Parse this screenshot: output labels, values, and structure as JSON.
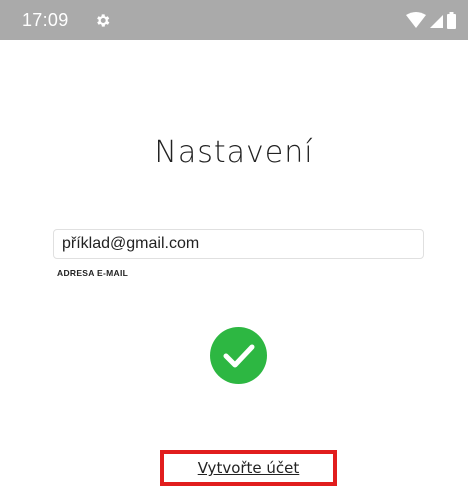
{
  "status_bar": {
    "time": "17:09",
    "icons": [
      "settings-gear-icon",
      "wifi-icon",
      "signal-icon",
      "battery-icon"
    ],
    "background": "#aaaaaa"
  },
  "screen": {
    "title": "Nastavení",
    "email": {
      "value": "příklad@gmail.com",
      "label": "ADRESA E-MAIL"
    },
    "success_icon": "check-circle-icon",
    "success_color": "#2db742",
    "create_account_link": "Vytvořte účet",
    "highlight_color": "#e11d1d"
  }
}
